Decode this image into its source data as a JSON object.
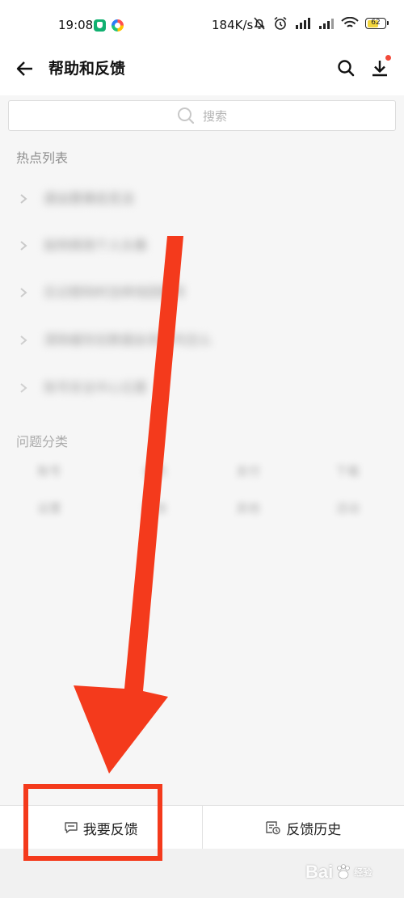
{
  "status_bar": {
    "time": "19:08",
    "net_speed": "184K/s",
    "battery_level": "62",
    "battery_fraction": 0.62
  },
  "header": {
    "title": "帮助和反馈"
  },
  "search": {
    "placeholder": "搜索"
  },
  "hot_list": {
    "title": "热点列表",
    "items": [
      "退出登录后无法",
      "如何修改个人头像",
      "忘记密码时怎样找回账号",
      "清除缓存后数据会丢失吗怎么",
      "账号安全中心位置"
    ]
  },
  "categories": {
    "title": "问题分类",
    "items": [
      "账号",
      "会员",
      "支付",
      "下载",
      "设置",
      "播放",
      "其他",
      "活动"
    ]
  },
  "bottom_bar": {
    "feedback_label": "我要反馈",
    "history_label": "反馈历史"
  },
  "watermark": {
    "text": "Bai",
    "sub": "经验"
  },
  "colors": {
    "annotation_red": "#f43a1c",
    "notification_dot": "#f24a3a",
    "battery_yellow": "#f2d53c"
  }
}
